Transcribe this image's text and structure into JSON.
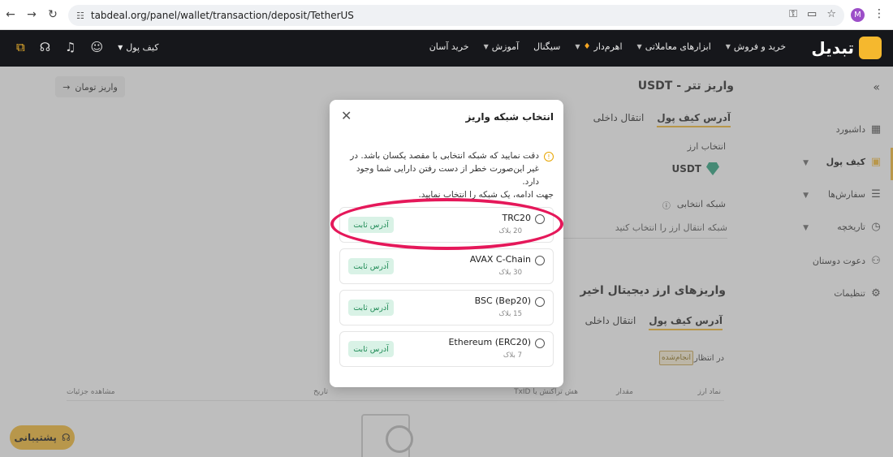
{
  "browser": {
    "url": "tabdeal.org/panel/wallet/transaction/deposit/TetherUS",
    "profile_initial": "M"
  },
  "header": {
    "brand": "تبدیل",
    "menu": [
      {
        "label": "خرید و فروش",
        "caret": true
      },
      {
        "label": "ابزارهای معاملاتی",
        "caret": true
      },
      {
        "label": "اهرم‌دار",
        "caret": true
      },
      {
        "label": "سیگنال",
        "caret": false
      },
      {
        "label": "آموزش",
        "caret": true
      },
      {
        "label": "خرید آسان",
        "caret": false
      }
    ],
    "wallet_label": "کیف پول"
  },
  "sidebar": {
    "items": [
      {
        "label": "داشبورد",
        "icon": "dashboard-icon"
      },
      {
        "label": "کیف پول",
        "icon": "wallet-icon"
      },
      {
        "label": "سفارش‌ها",
        "icon": "orders-icon"
      },
      {
        "label": "تاریخچه",
        "icon": "history-icon"
      },
      {
        "label": "دعوت دوستان",
        "icon": "invite-icon"
      },
      {
        "label": "تنظیمات",
        "icon": "settings-icon"
      }
    ]
  },
  "page": {
    "title": "واریز تتر - USDT",
    "toman_button": "واریز تومان",
    "tab_address": "آدرس کیف پول",
    "tab_internal": "انتقال داخلی",
    "currency_label": "انتخاب ارز",
    "currency_value": "USDT",
    "network_label": "شبکه انتخابی",
    "network_placeholder": "شبکه انتقال ارز را انتخاب کنید",
    "recent_title": "واریزهای ارز دیجیتال اخیر",
    "status_pending": "در انتظار",
    "status_done": "انجام‌شده",
    "table_headers": [
      "نماد ارز",
      "مقدار",
      "هش تراکنش یا TxID",
      "تاریخ",
      "مشاهده جزئیات"
    ],
    "support": "پشتیبانی"
  },
  "modal": {
    "title": "انتخاب شبکه واریز",
    "warning": "دقت نمایید که شبکه انتخابی با مقصد یکسان باشد. در غیر این‌صورت خطر از دست رفتن دارایی شما وجود دارد.",
    "hint": "جهت ادامه، یک شبکه را انتخاب نمایید.",
    "networks": [
      {
        "name": "TRC20",
        "blocks": "20 بلاک",
        "badge": "آدرس ثابت"
      },
      {
        "name": "AVAX C-Chain",
        "blocks": "30 بلاک",
        "badge": "آدرس ثابت"
      },
      {
        "name": "BSC (Bep20)",
        "blocks": "15 بلاک",
        "badge": "آدرس ثابت"
      },
      {
        "name": "Ethereum (ERC20)",
        "blocks": "7 بلاک",
        "badge": "آدرس ثابت"
      }
    ]
  },
  "colors": {
    "brand": "#f5b82e",
    "header_bg": "#16171b",
    "badge_bg": "#d9f2e6",
    "badge_text": "#1e8a55",
    "highlight": "#e5185a"
  }
}
